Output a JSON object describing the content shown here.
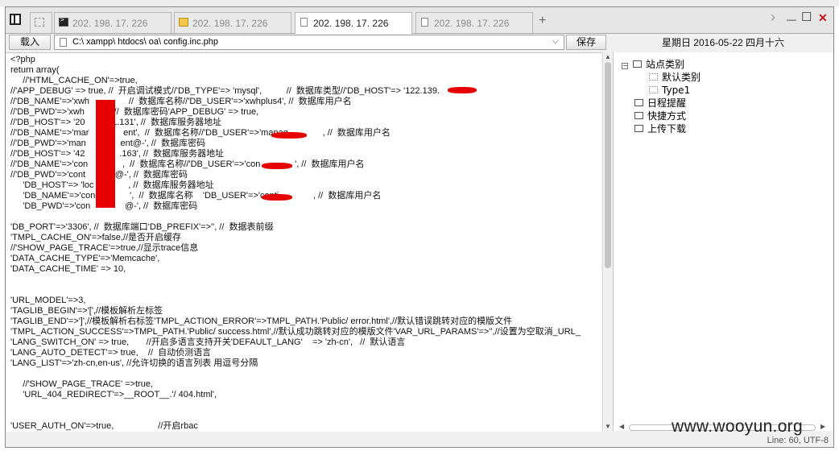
{
  "tabs": [
    {
      "label": "",
      "icon": "grid-icon"
    },
    {
      "label": "202. 198. 17. 226",
      "icon": "terminal-icon"
    },
    {
      "label": "202. 198. 17. 226",
      "icon": "folder-icon"
    },
    {
      "label": "202. 198. 17. 226",
      "icon": "document-icon",
      "active": true
    },
    {
      "label": "202. 198. 17. 226",
      "icon": "document-icon"
    }
  ],
  "tab_add": "+",
  "window_controls": {
    "nav": "›",
    "minimize": "—",
    "maximize": "☐",
    "close": "✕"
  },
  "toolbar": {
    "load_label": "载入",
    "path": "C:\\ xampp\\ htdocs\\ oa\\ config.inc.php",
    "save_label": "保存"
  },
  "date_header": "星期日  2016-05-22  四月十六",
  "code_lines": [
    "<?php",
    "return array(",
    "     //'HTML_CACHE_ON'=>true,",
    "//'APP_DEBUG' => true, //  开启调试模式//'DB_TYPE'=> 'mysql',          //  数据库类型//'DB_HOST'=> '122.139.",
    "//'DB_NAME'=>'xwh                //  数据库名称//'DB_USER'=>'xwhplus4', //  数据库用户名",
    "//'DB_PWD'=>'xwh            //  数据库密码'APP_DEBUG' => true,",
    "//'DB_HOST'=> '20           1.131', //  数据库服务器地址",
    "//'DB_NAME'=>'mar              ent',  //  数据库名称//'DB_USER'=>'manag              , //  数据库用户名",
    "//'DB_PWD'=>'man              ent@-', //  数据库密码",
    "//'DB_HOST'=> '42              .163', //  数据库服务器地址",
    "//'DB_NAME'=>'con              ,  //  数据库名称//'DB_USER'=>'con              ', //  数据库用户名",
    "//'DB_PWD'=>'cont            @-', //  数据库密码",
    "     'DB_HOST'=> 'loc              , //  数据库服务器地址",
    "     'DB_NAME'=>'con              ',  //  数据库名称    'DB_USER'=>'conti              , //  数据库用户名",
    "     'DB_PWD'=>'con              @-', //  数据库密码",
    "",
    "'DB_PORT'=>'3306', //  数据库端口'DB_PREFIX'=>'', //  数据表前缀",
    "'TMPL_CACHE_ON'=>false,//是否开启缓存",
    "//'SHOW_PAGE_TRACE'=>true,//显示trace信息",
    "'DATA_CACHE_TYPE'=>'Memcache',",
    "'DATA_CACHE_TIME' => 10,",
    "",
    "",
    "'URL_MODEL'=>3,",
    "'TAGLIB_BEGIN'=>'[',//模板解析左标签",
    "'TAGLIB_END'=>']',//模板解析右标签'TMPL_ACTION_ERROR'=>TMPL_PATH.'Public/ error.html',//默认错误跳转对应的模版文件",
    "'TMPL_ACTION_SUCCESS'=>TMPL_PATH.'Public/ success.html',//默认成功跳转对应的模版文件'VAR_URL_PARAMS'=>'',//设置为空取消_URL_",
    "'LANG_SWITCH_ON' => true,       //开启多语言支持开关'DEFAULT_LANG'    => 'zh-cn',   //  默认语言",
    "'LANG_AUTO_DETECT'=> true,    //  自动侦测语言",
    "'LANG_LIST'=>'zh-cn,en-us', //允许切换的语言列表 用逗号分隔",
    "",
    "     //'SHOW_PAGE_TRACE' =>true,",
    "     'URL_404_REDIRECT'=>__ROOT__.'/ 404.html',",
    "",
    "",
    "'USER_AUTH_ON'=>true,                  //开启rbac"
  ],
  "tree": {
    "root": {
      "label": "站点类别",
      "expander": "−"
    },
    "children": [
      "默认类别",
      "Type1"
    ],
    "items": [
      "日程提醒",
      "快捷方式",
      "上传下载"
    ]
  },
  "status": "Line: 60, UTF-8",
  "watermark": "www.wooyun.org"
}
